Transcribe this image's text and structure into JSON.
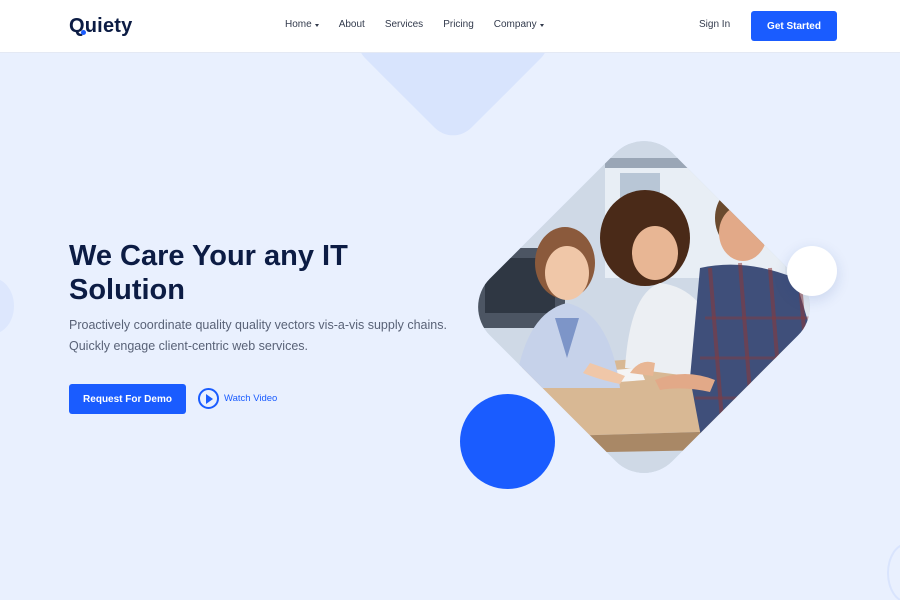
{
  "brand": {
    "name": "Quiety",
    "first_letter": "Q",
    "rest": "uiety"
  },
  "nav": {
    "items": [
      {
        "label": "Home",
        "has_dropdown": true
      },
      {
        "label": "About",
        "has_dropdown": false
      },
      {
        "label": "Services",
        "has_dropdown": false
      },
      {
        "label": "Pricing",
        "has_dropdown": false
      },
      {
        "label": "Company",
        "has_dropdown": true
      }
    ],
    "signin": "Sign In",
    "cta": "Get Started"
  },
  "hero": {
    "title": "We Care Your any IT Solution",
    "subtitle": "Proactively coordinate quality quality vectors vis-a-vis supply chains. Quickly engage client-centric web services.",
    "primary_button": "Request For Demo",
    "video_link": "Watch Video"
  },
  "colors": {
    "accent": "#1a5cff",
    "heading": "#0c1c44",
    "background": "#e9f0fe"
  },
  "image": {
    "subject": "team-meeting-photo"
  }
}
